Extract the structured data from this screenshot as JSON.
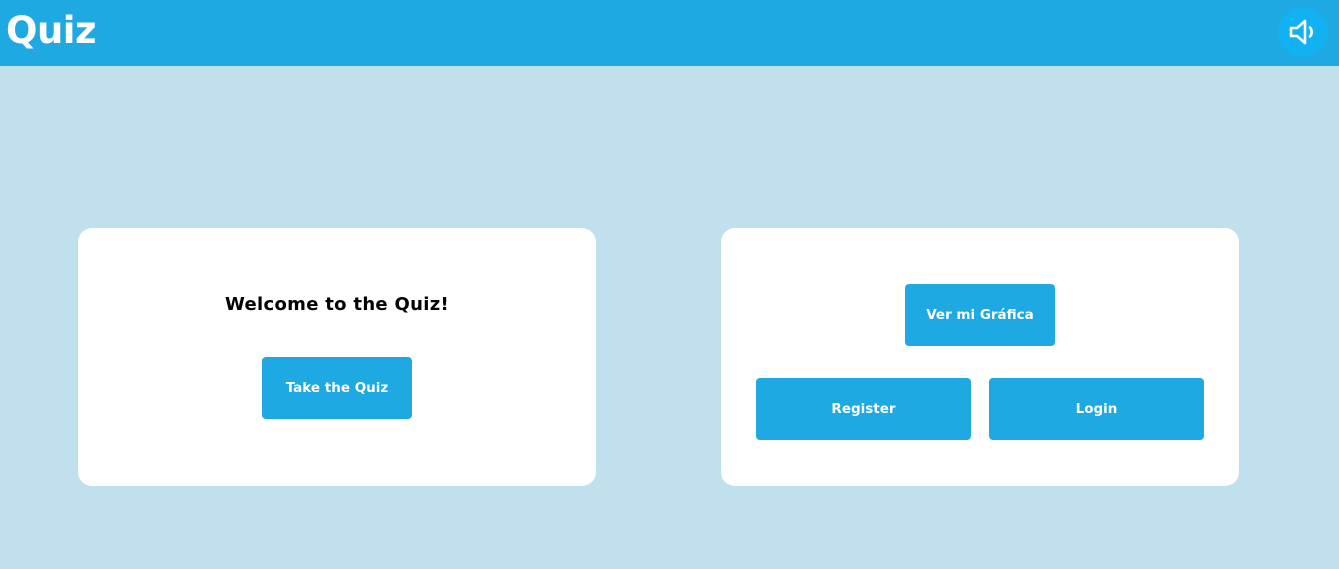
{
  "header": {
    "title": "Quiz",
    "sound_icon": "speaker-icon"
  },
  "colors": {
    "header_bg": "#1ea9e2",
    "page_bg": "#c1e0ed",
    "button_bg": "#1ea9e2",
    "sound_button_bg": "#12b1f2",
    "card_bg": "#ffffff"
  },
  "welcome_card": {
    "heading": "Welcome to the Quiz!",
    "take_quiz_label": "Take the Quiz"
  },
  "account_card": {
    "grafica_label": "Ver mi Gráfica",
    "register_label": "Register",
    "login_label": "Login"
  }
}
